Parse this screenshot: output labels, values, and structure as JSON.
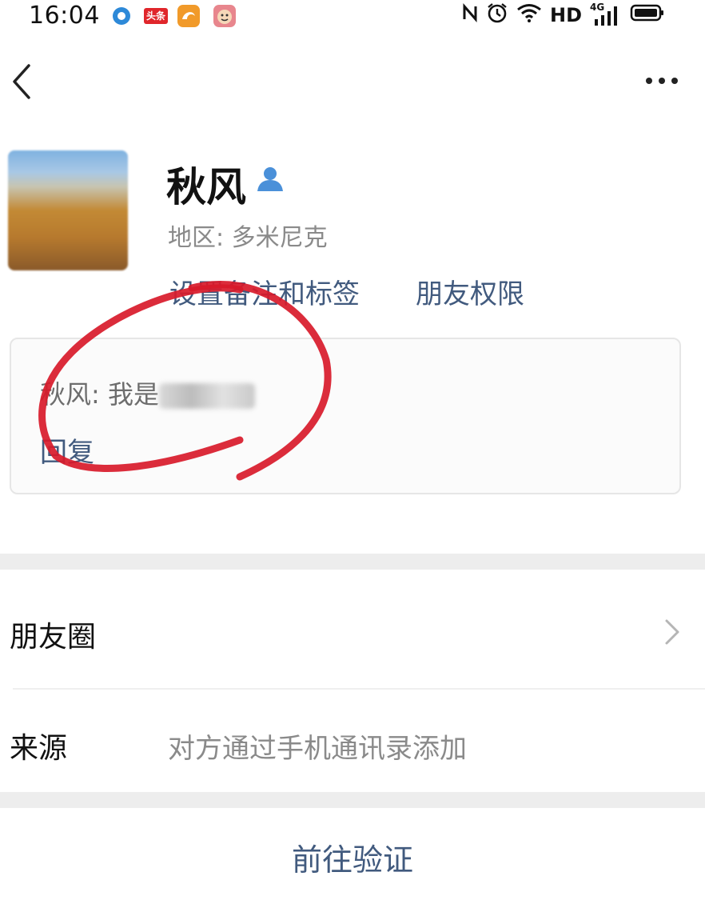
{
  "status_bar": {
    "time": "16:04",
    "app_icons": [
      "record-icon",
      "toutiao-icon",
      "uc-browser-icon",
      "avatar-app-icon"
    ],
    "toutiao_label": "头条",
    "right_icons": [
      "nfc-icon",
      "alarm-icon",
      "wifi-icon",
      "hd-label",
      "signal-4g-icon",
      "battery-icon"
    ],
    "hd_text": "HD",
    "net_text": "4G"
  },
  "header": {
    "back_icon": "chevron-left-icon",
    "more_icon": "more-dots-icon"
  },
  "profile": {
    "nickname": "秋风",
    "region": "地区: 多米尼克",
    "remark_link": "设置备注和标签",
    "permission_link": "朋友权限"
  },
  "message": {
    "text": "秋风: 我是",
    "reply_label": "回复"
  },
  "rows": {
    "moments_label": "朋友圈",
    "source_label": "来源",
    "source_value": "对方通过手机通讯录添加"
  },
  "actions": {
    "verify_label": "前往验证"
  },
  "colors": {
    "link": "#415a7e",
    "scribble": "#d81a2a",
    "band": "#ededed"
  }
}
